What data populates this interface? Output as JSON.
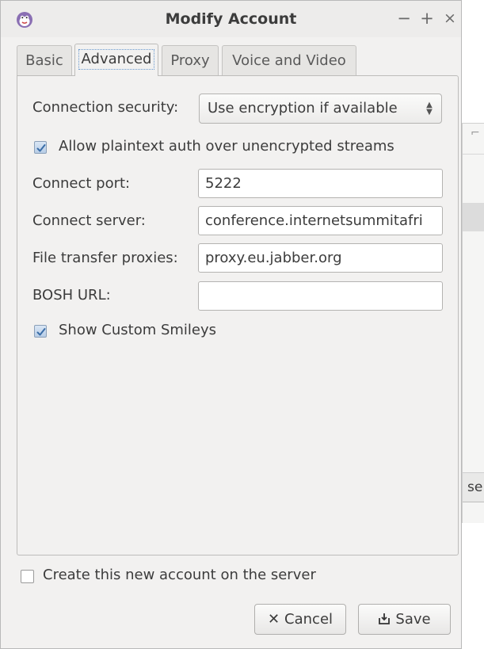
{
  "window": {
    "title": "Modify Account",
    "controls": {
      "minimize": "−",
      "maximize": "+",
      "close": "×"
    }
  },
  "tabs": [
    {
      "label": "Basic",
      "active": false
    },
    {
      "label": "Advanced",
      "active": true
    },
    {
      "label": "Proxy",
      "active": false
    },
    {
      "label": "Voice and Video",
      "active": false
    }
  ],
  "advanced": {
    "connection_security": {
      "label": "Connection security:",
      "value": "Use encryption if available"
    },
    "allow_plaintext": {
      "label": "Allow plaintext auth over unencrypted streams",
      "checked": true
    },
    "connect_port": {
      "label": "Connect port:",
      "value": "5222"
    },
    "connect_server": {
      "label": "Connect server:",
      "value": "conference.internetsummitafri"
    },
    "file_transfer_proxies": {
      "label": "File transfer proxies:",
      "value": "proxy.eu.jabber.org"
    },
    "bosh_url": {
      "label": "BOSH URL:",
      "value": ""
    },
    "show_custom_smileys": {
      "label": "Show Custom Smileys",
      "checked": true
    }
  },
  "create_account": {
    "label": "Create this new account on the server",
    "checked": false
  },
  "buttons": {
    "cancel": {
      "label": "Cancel",
      "icon": "close-icon"
    },
    "save": {
      "label": "Save",
      "icon": "save-icon"
    }
  },
  "background_window": {
    "partial_text": "se"
  },
  "colors": {
    "window_bg": "#f2f1f0",
    "checkbox_fill": "#c7d8ec",
    "checkmark": "#3b6ea8"
  }
}
